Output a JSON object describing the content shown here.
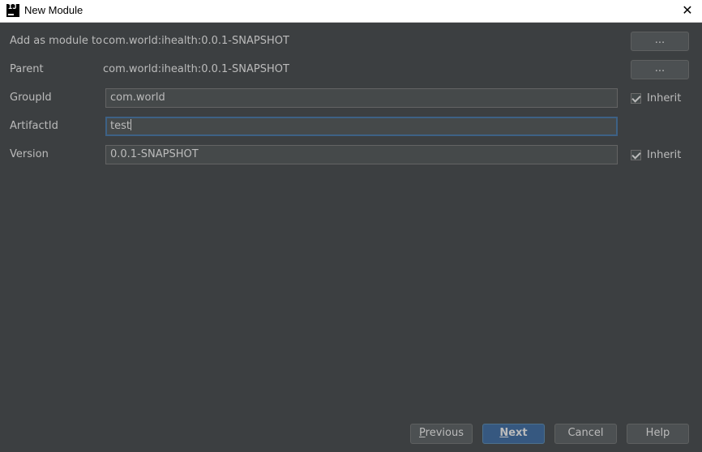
{
  "window": {
    "title": "New Module",
    "icon_text": "IJ"
  },
  "form": {
    "add_as_module_to": {
      "label": "Add as module to",
      "value": "com.world:ihealth:0.0.1-SNAPSHOT",
      "button": "..."
    },
    "parent": {
      "label": "Parent",
      "value": "com.world:ihealth:0.0.1-SNAPSHOT",
      "button": "..."
    },
    "group_id": {
      "label": "GroupId",
      "value": "com.world",
      "inherit_label": "Inherit",
      "inherit_checked": true
    },
    "artifact_id": {
      "label": "ArtifactId",
      "value": "test"
    },
    "version": {
      "label": "Version",
      "value": "0.0.1-SNAPSHOT",
      "inherit_label": "Inherit",
      "inherit_checked": true
    }
  },
  "footer": {
    "previous": {
      "mnemonic": "P",
      "rest": "revious"
    },
    "next": {
      "mnemonic": "N",
      "rest": "ext"
    },
    "cancel": "Cancel",
    "help": "Help"
  },
  "colors": {
    "background": "#3c3f41",
    "primary_button": "#365880",
    "focus_border": "#3d6185"
  },
  "icons": {
    "close": "close-icon",
    "app": "intellij-icon",
    "check": "check-icon"
  }
}
